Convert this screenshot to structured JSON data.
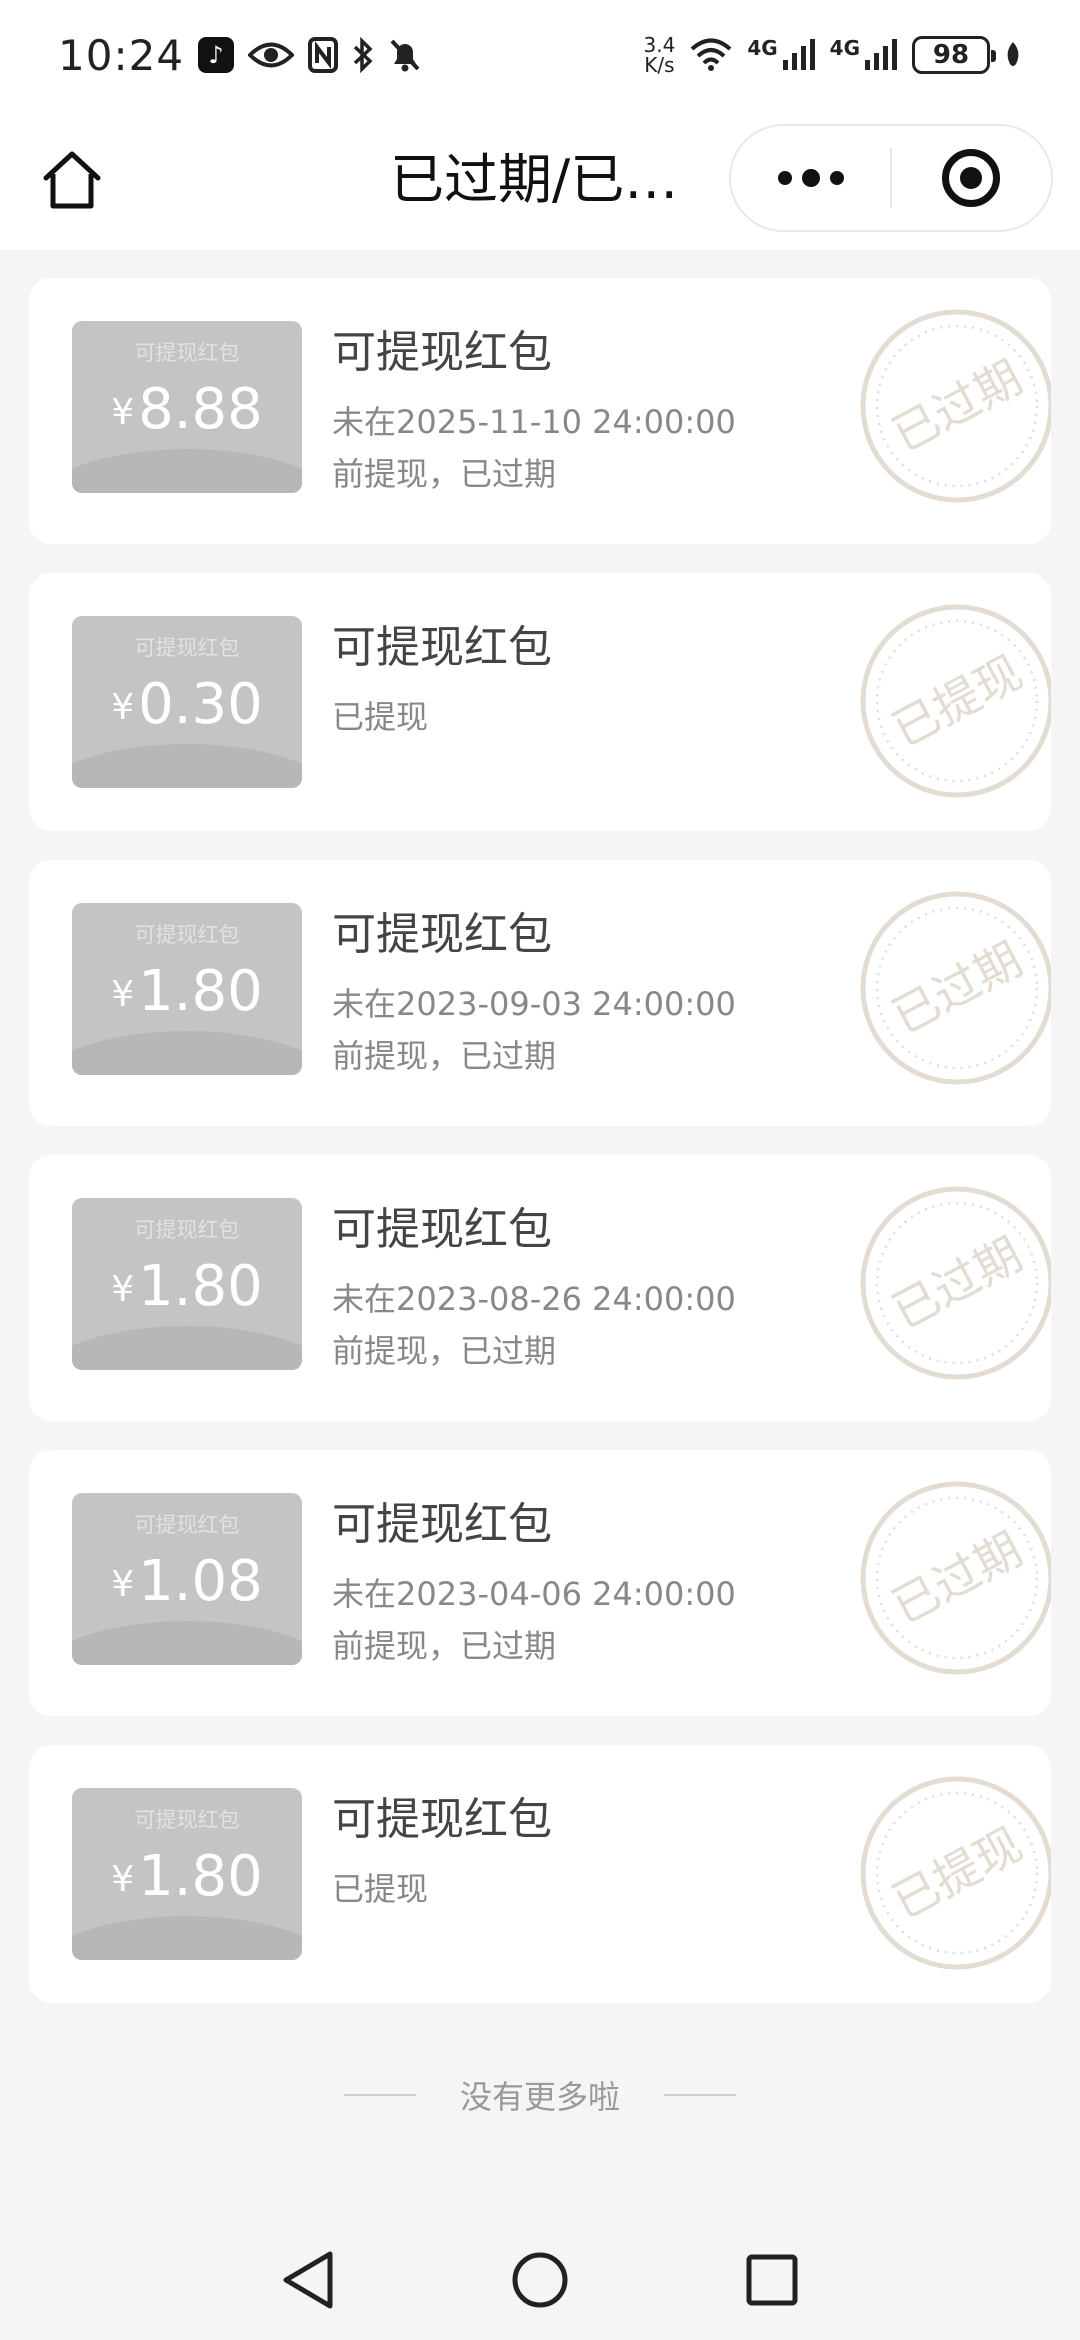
{
  "status_bar": {
    "time": "10:24",
    "netspeed_value": "3.4",
    "netspeed_unit": "K/s",
    "signal1_label": "4G",
    "signal2_label": "4G",
    "battery": "98"
  },
  "nav": {
    "title": "已过期/已提现"
  },
  "cards": [
    {
      "coupon_label": "可提现红包",
      "currency": "¥",
      "amount": "8.88",
      "title": "可提现红包",
      "desc_line1": "未在2025-11-10 24:00:00",
      "desc_line2": "前提现，已过期",
      "stamp": "已过期"
    },
    {
      "coupon_label": "可提现红包",
      "currency": "¥",
      "amount": "0.30",
      "title": "可提现红包",
      "desc_line1": "已提现",
      "desc_line2": "",
      "stamp": "已提现"
    },
    {
      "coupon_label": "可提现红包",
      "currency": "¥",
      "amount": "1.80",
      "title": "可提现红包",
      "desc_line1": "未在2023-09-03 24:00:00",
      "desc_line2": "前提现，已过期",
      "stamp": "已过期"
    },
    {
      "coupon_label": "可提现红包",
      "currency": "¥",
      "amount": "1.80",
      "title": "可提现红包",
      "desc_line1": "未在2023-08-26 24:00:00",
      "desc_line2": "前提现，已过期",
      "stamp": "已过期"
    },
    {
      "coupon_label": "可提现红包",
      "currency": "¥",
      "amount": "1.08",
      "title": "可提现红包",
      "desc_line1": "未在2023-04-06 24:00:00",
      "desc_line2": "前提现，已过期",
      "stamp": "已过期"
    },
    {
      "coupon_label": "可提现红包",
      "currency": "¥",
      "amount": "1.80",
      "title": "可提现红包",
      "desc_line1": "已提现",
      "desc_line2": "",
      "stamp": "已提现"
    }
  ],
  "footer": {
    "no_more_text": "没有更多啦"
  },
  "colors": {
    "coupon_bg": "#c4c4c4",
    "stamp": "#e3dcd3",
    "page_bg": "#f5f5f5"
  }
}
